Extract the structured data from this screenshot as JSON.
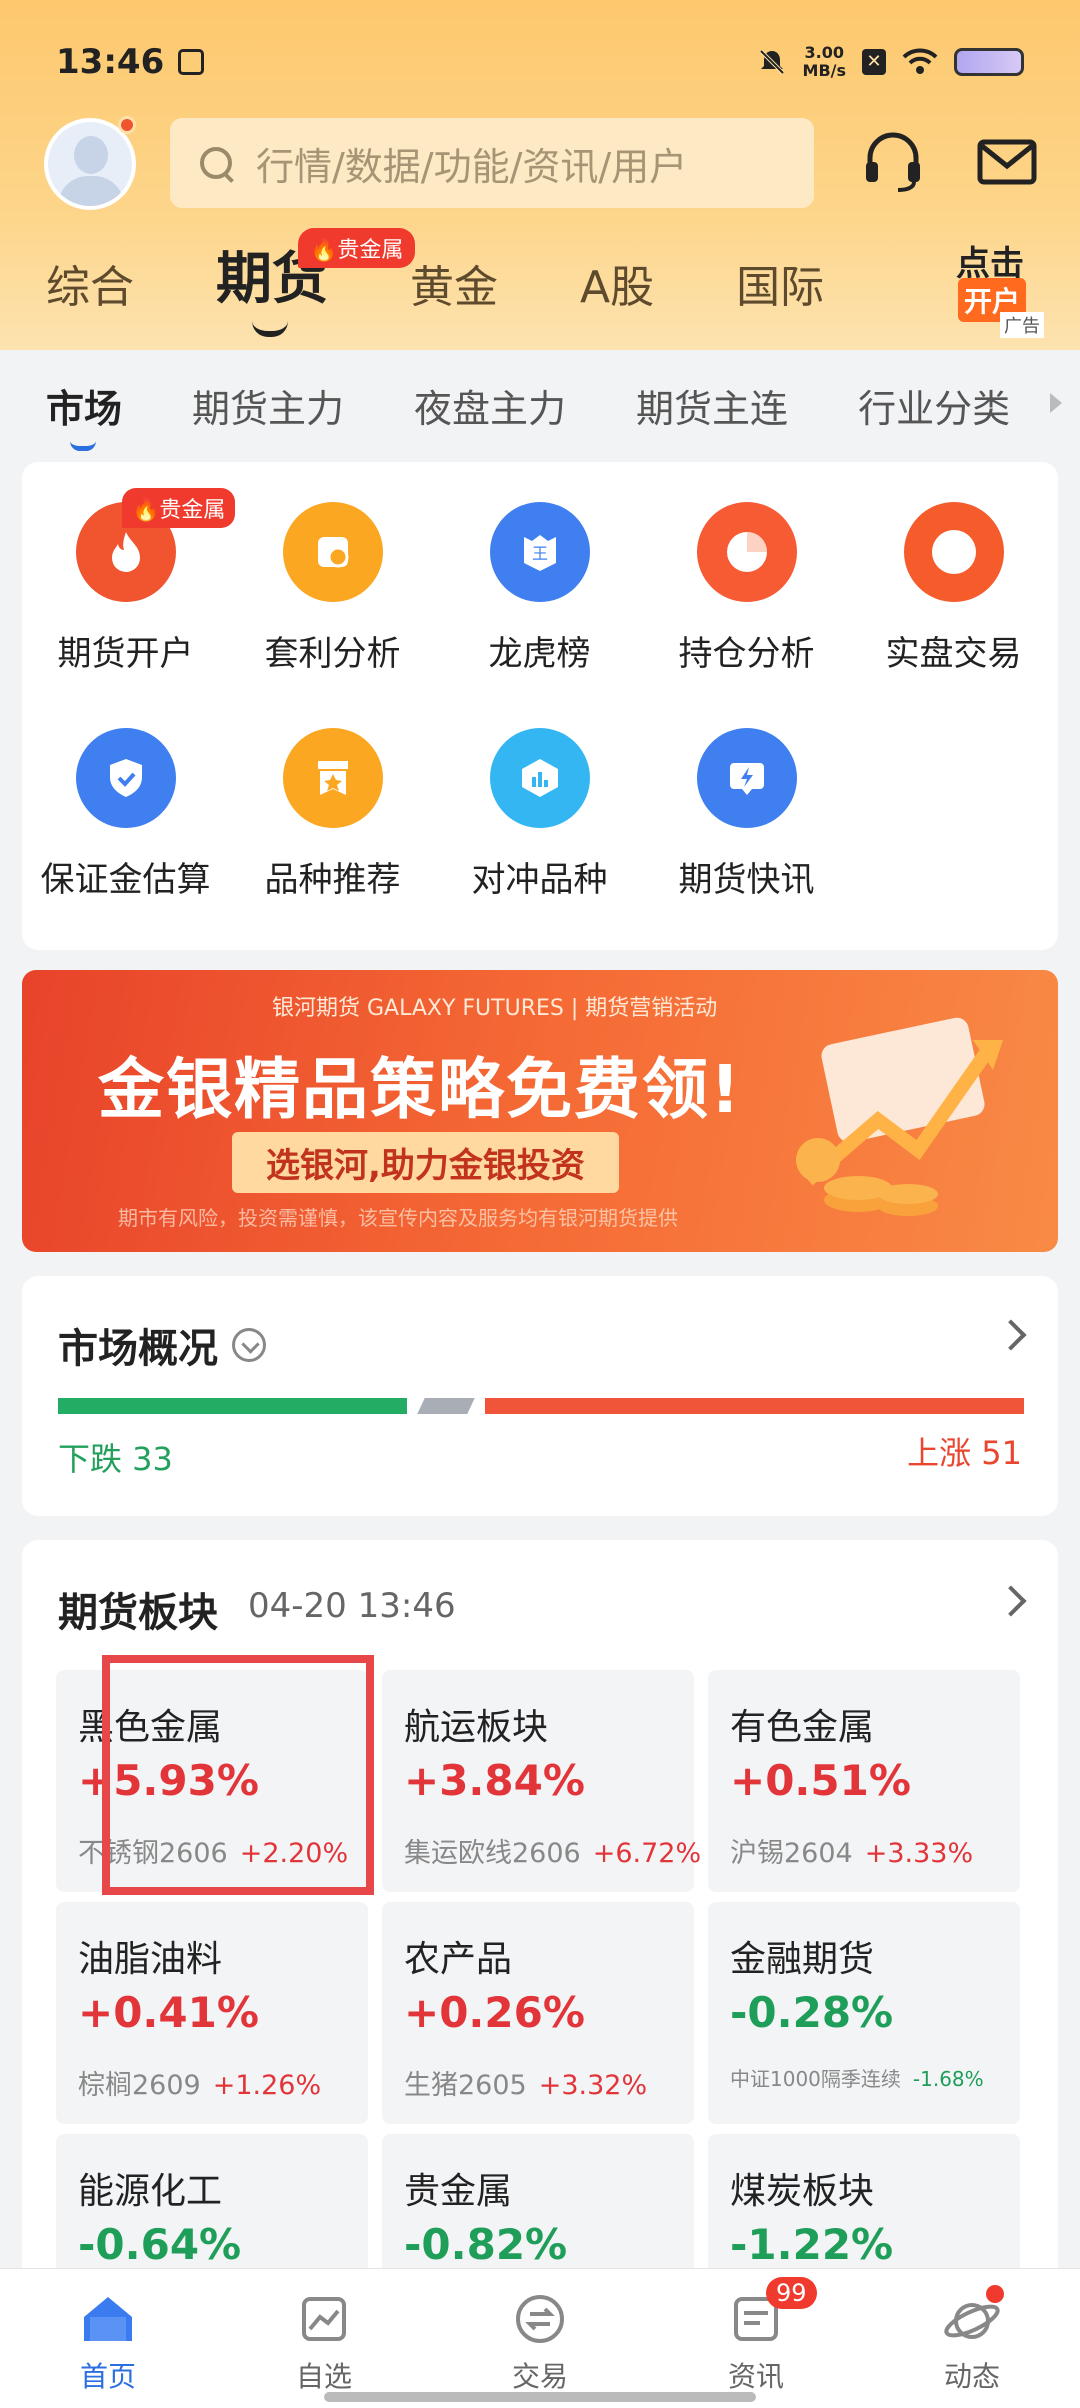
{
  "status_bar": {
    "time": "13:46",
    "speed": "3.00",
    "speed_unit": "MB/s"
  },
  "search": {
    "placeholder": "行情/数据/功能/资讯/用户"
  },
  "top_tabs": [
    {
      "label": "综合",
      "active": false
    },
    {
      "label": "期货",
      "active": true
    },
    {
      "label": "黄金",
      "active": false
    },
    {
      "label": "A股",
      "active": false
    },
    {
      "label": "国际",
      "active": false
    }
  ],
  "top_tab_badge": "贵金属",
  "ad": {
    "line1": "点击",
    "line2": "开户",
    "tag": "广告"
  },
  "sub_tabs": [
    {
      "label": "市场",
      "active": true
    },
    {
      "label": "期货主力",
      "active": false
    },
    {
      "label": "夜盘主力",
      "active": false
    },
    {
      "label": "期货主连",
      "active": false
    },
    {
      "label": "行业分类",
      "active": false
    }
  ],
  "features": [
    {
      "label": "期货开户",
      "icon": "flame-icon",
      "color": "#f0552f",
      "badge": "贵金属"
    },
    {
      "label": "套利分析",
      "icon": "coin-icon",
      "color": "#fba722"
    },
    {
      "label": "龙虎榜",
      "icon": "shield-king-icon",
      "color": "#3f7ff0"
    },
    {
      "label": "持仓分析",
      "icon": "pie-icon",
      "color": "#f65b34"
    },
    {
      "label": "实盘交易",
      "icon": "ring-icon",
      "color": "#f65b2b"
    },
    {
      "label": "保证金估算",
      "icon": "shield-check-icon",
      "color": "#3f7ff0"
    },
    {
      "label": "品种推荐",
      "icon": "ribbon-star-icon",
      "color": "#fba722"
    },
    {
      "label": "对冲品种",
      "icon": "bar-chart-icon",
      "color": "#34b6f3"
    },
    {
      "label": "期货快讯",
      "icon": "flash-screen-icon",
      "color": "#3f7ff0"
    }
  ],
  "banner": {
    "brand": "银河期货 GALAXY FUTURES | 期货营销活动",
    "headline": "金银精品策略免费领!",
    "pill": "选银河,助力金银投资",
    "disclaimer": "期市有风险，投资需谨慎，该宣传内容及服务均有银河期货提供"
  },
  "market_overview": {
    "title": "市场概况",
    "fall_label": "下跌",
    "fall_count": 33,
    "rise_label": "上涨",
    "rise_count": 51,
    "fall_text": "下跌 33",
    "rise_text": "上涨 51",
    "colors": {
      "fall": "#23ad64",
      "flat": "#a9adb5",
      "rise": "#f0553a"
    }
  },
  "sectors": {
    "title": "期货板块",
    "time": "04-20 13:46",
    "tiles": [
      {
        "name": "黑色金属",
        "pct": "+5.93%",
        "dir": "up",
        "contract": "不锈钢2606",
        "contract_pct": "+2.20%"
      },
      {
        "name": "航运板块",
        "pct": "+3.84%",
        "dir": "up",
        "contract": "集运欧线2606",
        "contract_pct": "+6.72%"
      },
      {
        "name": "有色金属",
        "pct": "+0.51%",
        "dir": "up",
        "contract": "沪锡2604",
        "contract_pct": "+3.33%"
      },
      {
        "name": "油脂油料",
        "pct": "+0.41%",
        "dir": "up",
        "contract": "棕榈2609",
        "contract_pct": "+1.26%"
      },
      {
        "name": "农产品",
        "pct": "+0.26%",
        "dir": "up",
        "contract": "生猪2605",
        "contract_pct": "+3.32%"
      },
      {
        "name": "金融期货",
        "pct": "-0.28%",
        "dir": "dn",
        "contract": "中证1000隔季连续",
        "contract_pct": "-1.68%"
      },
      {
        "name": "能源化工",
        "pct": "-0.64%",
        "dir": "dn",
        "contract": "",
        "contract_pct": ""
      },
      {
        "name": "贵金属",
        "pct": "-0.82%",
        "dir": "dn",
        "contract": "",
        "contract_pct": ""
      },
      {
        "name": "煤炭板块",
        "pct": "-1.22%",
        "dir": "dn",
        "contract": "",
        "contract_pct": ""
      }
    ]
  },
  "bottom_nav": [
    {
      "label": "首页",
      "icon": "home-icon",
      "active": true
    },
    {
      "label": "自选",
      "icon": "watchlist-icon",
      "active": false
    },
    {
      "label": "交易",
      "icon": "trade-icon",
      "active": false
    },
    {
      "label": "资讯",
      "icon": "news-icon",
      "active": false,
      "count": "99"
    },
    {
      "label": "动态",
      "icon": "planet-icon",
      "active": false,
      "dot": true
    }
  ]
}
